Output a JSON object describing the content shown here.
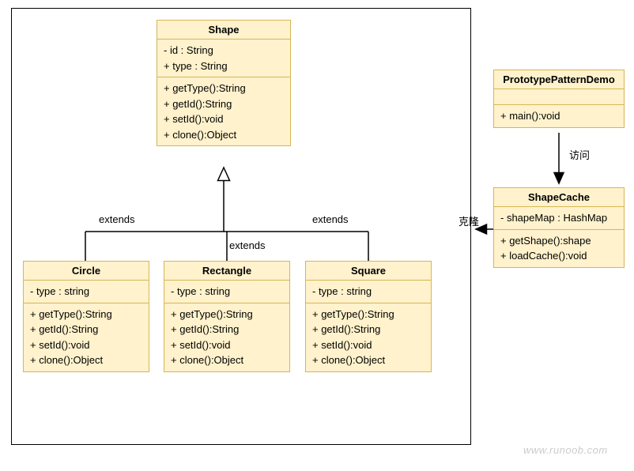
{
  "classes": {
    "shape": {
      "name": "Shape",
      "attributes": "- id : String\n+ type : String",
      "methods": "+ getType():String\n+ getId():String\n+ setId():void\n+ clone():Object"
    },
    "circle": {
      "name": "Circle",
      "attributes": "- type : string",
      "methods": "+ getType():String\n+ getId():String\n+ setId():void\n+ clone():Object"
    },
    "rectangle": {
      "name": "Rectangle",
      "attributes": "- type : string",
      "methods": "+ getType():String\n+ getId():String\n+ setId():void\n+ clone():Object"
    },
    "square": {
      "name": "Square",
      "attributes": "- type : string",
      "methods": "+ getType():String\n+ getId():String\n+ setId():void\n+ clone():Object"
    },
    "demo": {
      "name": "PrototypePatternDemo",
      "attributes": "",
      "methods": "+ main():void"
    },
    "cache": {
      "name": "ShapeCache",
      "attributes": "- shapeMap : HashMap",
      "methods": "+ getShape():shape\n+ loadCache():void"
    }
  },
  "labels": {
    "extends1": "extends",
    "extends2": "extends",
    "extends3": "extends",
    "visit": "访问",
    "clone": "克隆"
  },
  "watermark": "www.runoob.com"
}
